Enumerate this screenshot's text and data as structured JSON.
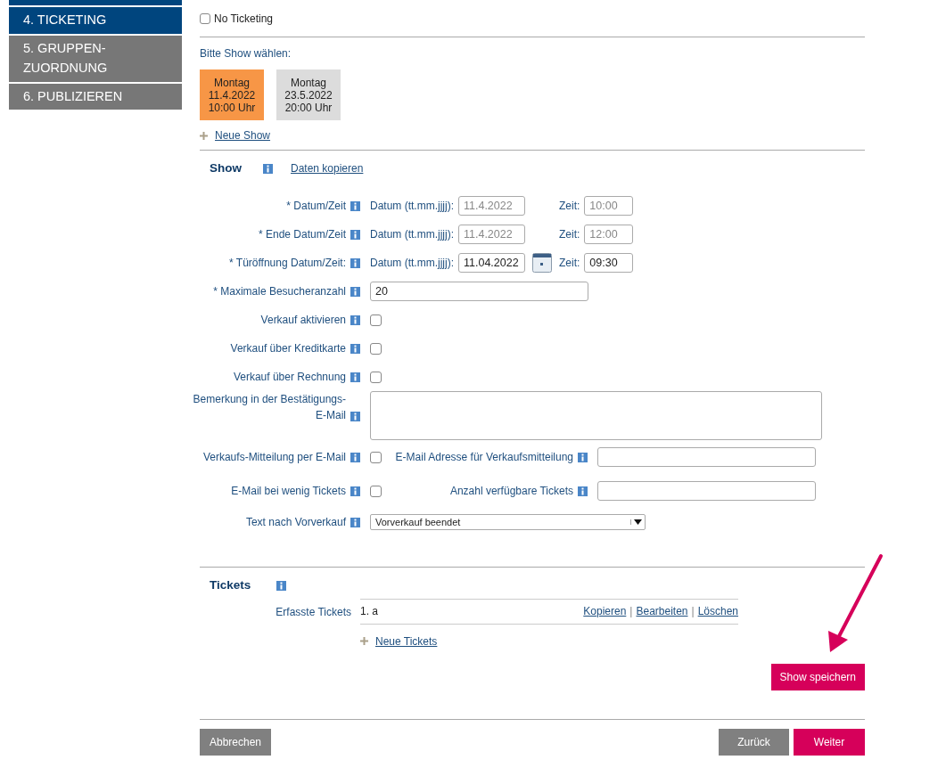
{
  "sidebar": {
    "items": [
      {
        "label": "4. TICKETING",
        "selected": true
      },
      {
        "label": "5. GRUPPEN-\nZUORDNUNG",
        "selected": false
      },
      {
        "label": "6. PUBLIZIEREN",
        "selected": false
      }
    ]
  },
  "no_ticketing": {
    "label": "No Ticketing",
    "checked": false
  },
  "show_picker": {
    "label": "Bitte Show wählen:",
    "shows": [
      {
        "day": "Montag",
        "date": "11.4.2022",
        "time": "10:00 Uhr",
        "selected": true
      },
      {
        "day": "Montag",
        "date": "23.5.2022",
        "time": "20:00 Uhr",
        "selected": false
      }
    ],
    "add_link": "Neue Show"
  },
  "show_section": {
    "title": "Show",
    "copy_link": "Daten kopieren",
    "fields": [
      {
        "kind": "datetime",
        "label": "* Datum/Zeit",
        "date_label": "Datum (tt.mm.jjjj):",
        "date": "11.4.2022",
        "time_label": "Zeit:",
        "time": "10:00",
        "disabled": true,
        "calendar": false
      },
      {
        "kind": "datetime",
        "label": "* Ende Datum/Zeit",
        "date_label": "Datum (tt.mm.jjjj):",
        "date": "11.4.2022",
        "time_label": "Zeit:",
        "time": "12:00",
        "disabled": true,
        "calendar": false
      },
      {
        "kind": "datetime",
        "label": "* Türöffnung Datum/Zeit:",
        "date_label": "Datum (tt.mm.jjjj):",
        "date": "11.04.2022",
        "time_label": "Zeit:",
        "time": "09:30",
        "disabled": false,
        "calendar": true
      },
      {
        "kind": "text",
        "label": "* Maximale Besucheranzahl",
        "value": "20"
      },
      {
        "kind": "checkbox",
        "label": "Verkauf aktivieren",
        "checked": false
      },
      {
        "kind": "checkbox",
        "label": "Verkauf über Kreditkarte",
        "checked": false
      },
      {
        "kind": "checkbox",
        "label": "Verkauf über Rechnung",
        "checked": false
      },
      {
        "kind": "textarea",
        "label": "Bemerkung in der Bestätigungs-E-Mail"
      },
      {
        "kind": "checkbox_field",
        "label": "Verkaufs-Mitteilung per E-Mail",
        "checked": false,
        "field_label": "E-Mail Adresse für Verkaufsmitteilung"
      },
      {
        "kind": "checkbox_field",
        "label": "E-Mail bei wenig Tickets",
        "checked": false,
        "field_label": "Anzahl verfügbare Tickets"
      },
      {
        "kind": "select",
        "label": "Text nach Vorverkauf",
        "value": "Vorverkauf beendet"
      }
    ]
  },
  "tickets": {
    "title": "Tickets",
    "label": "Erfasste Tickets",
    "items": [
      {
        "text": "1. a",
        "actions": [
          "Kopieren",
          "Bearbeiten",
          "Löschen"
        ],
        "separator": "|"
      }
    ],
    "add_link": "Neue Tickets"
  },
  "save_button": "Show speichern",
  "footer": {
    "left_buttons": [
      {
        "label": "Abbrechen",
        "kind": "secondary"
      }
    ],
    "right_buttons": [
      {
        "label": "Zurück",
        "kind": "secondary"
      },
      {
        "label": "Weiter",
        "kind": "primary"
      }
    ]
  }
}
